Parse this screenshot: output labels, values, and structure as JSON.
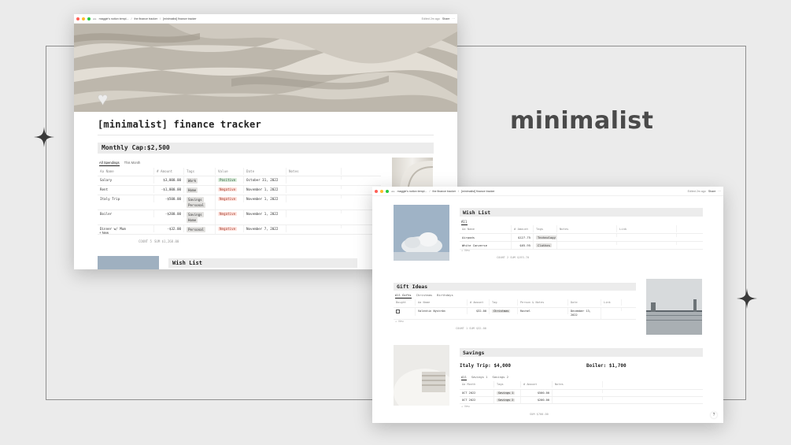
{
  "headline": "minimalist",
  "window1": {
    "breadcrumb": [
      "maggie's notion templ...",
      "the finance tracker",
      "[minimalist] finance tracker"
    ],
    "edited": "Edited 2m ago",
    "share": "Share",
    "page_title": "[minimalist] finance tracker",
    "monthly_cap": "Monthly Cap:$2,500",
    "tabs": [
      "All Spendings",
      "This Month"
    ],
    "columns": [
      "Aa Name",
      "# Amount",
      "Tags",
      "Value",
      "Date",
      "Notes"
    ],
    "rows": [
      {
        "name": "Salary",
        "amount": "$3,000.00",
        "tags": [
          "Work"
        ],
        "value": "Positive",
        "value_kind": "g",
        "date": "October 31, 2022"
      },
      {
        "name": "Rent",
        "amount": "-$1,000.00",
        "tags": [
          "Home"
        ],
        "value": "Negative",
        "value_kind": "r",
        "date": "November 1, 2022"
      },
      {
        "name": "Italy Trip",
        "amount": "-$500.00",
        "tags": [
          "Savings",
          "Personal"
        ],
        "value": "Negative",
        "value_kind": "r",
        "date": "November 1, 2022"
      },
      {
        "name": "Boiler",
        "amount": "-$200.00",
        "tags": [
          "Savings",
          "Home"
        ],
        "value": "Negative",
        "value_kind": "r",
        "date": "November 1, 2022"
      },
      {
        "name": "Dinner w/ Mum",
        "amount": "-$32.00",
        "tags": [
          "Personal"
        ],
        "value": "Negative",
        "value_kind": "r",
        "date": "November 7, 2022"
      }
    ],
    "new_label": "+ New",
    "count_label": "COUNT 5",
    "sum_label": "SUM $1,268.00",
    "wishlist_peek": "Wish List"
  },
  "window2": {
    "breadcrumb": [
      "maggie's notion templ...",
      "the finance tracker",
      "[minimalist] finance tracker"
    ],
    "edited": "Edited 2m ago",
    "share": "Share",
    "wishlist": {
      "title": "Wish List",
      "tab": "All",
      "columns": [
        "Aa Name",
        "# Amount",
        "Tags",
        "Notes",
        "Link"
      ],
      "rows": [
        {
          "name": "Airpods",
          "amount": "$127.75",
          "tag": "Technology"
        },
        {
          "name": "White Converse",
          "amount": "$65.95",
          "tag": "Clothes"
        }
      ],
      "new_label": "+ New",
      "summary": "COUNT 2  SUM $193.70"
    },
    "gifts": {
      "title": "Gift Ideas",
      "tabs": [
        "All Gifts",
        "Christmas",
        "Birthdays"
      ],
      "columns": [
        "Bought",
        "Aa Name",
        "# Amount",
        "Tag",
        "Person & Notes",
        "Date",
        "Link"
      ],
      "rows": [
        {
          "name": "Valentin Nyström",
          "amount": "$32.00",
          "tag": "Christmas",
          "person": "Rachel",
          "date": "December 13, 2022"
        }
      ],
      "new_label": "+ New",
      "summary": "COUNT 1  SUM $32.00"
    },
    "savings": {
      "title": "Savings",
      "italy": "Italy Trip: $4,000",
      "boiler": "Boiler: $1,700",
      "tabs": [
        "All",
        "Savings 1",
        "Savings 2"
      ],
      "columns": [
        "Aa Month",
        "Tags",
        "# Amount",
        "Notes"
      ],
      "rows": [
        {
          "month": "OCT 2022",
          "tag": "Savings 1",
          "amount": "$500.00"
        },
        {
          "month": "OCT 2022",
          "tag": "Savings 2",
          "amount": "$200.00"
        }
      ],
      "new_label": "+ New",
      "summary": "SUM $700.00"
    },
    "help": "?"
  }
}
